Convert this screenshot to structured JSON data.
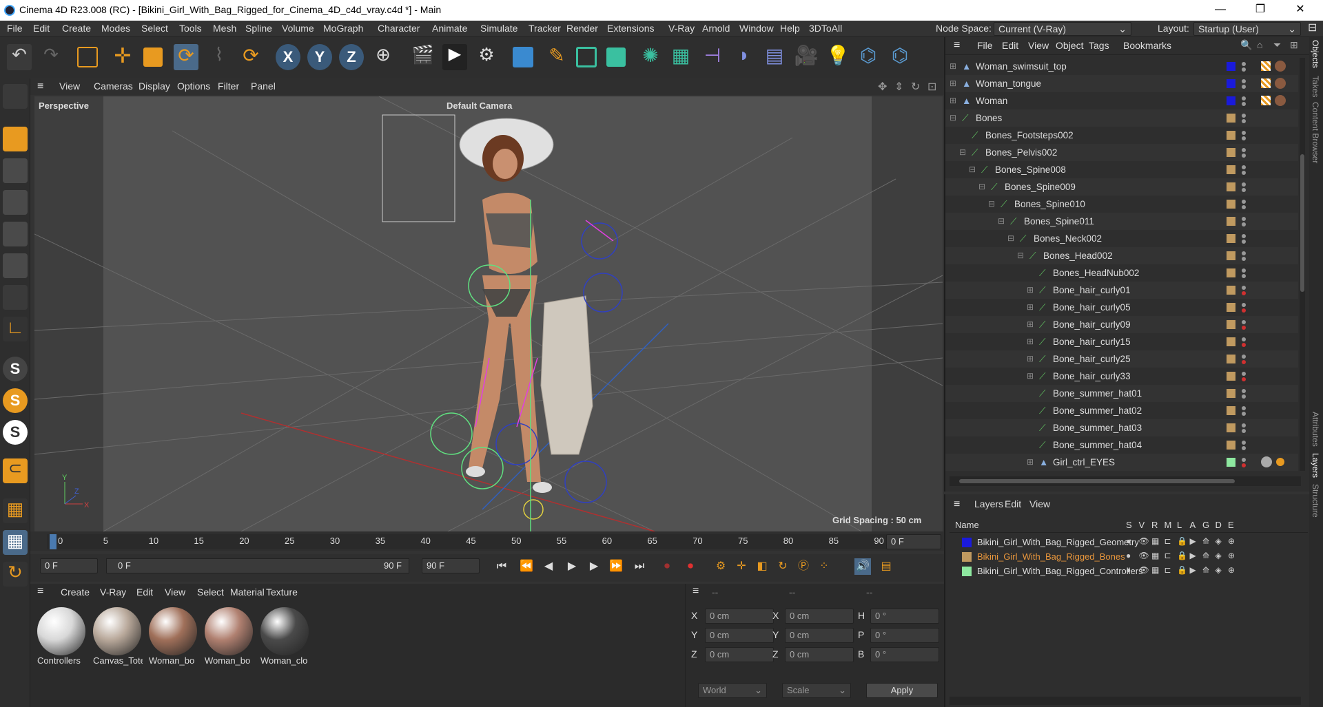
{
  "window": {
    "title": "Cinema 4D R23.008 (RC) - [Bikini_Girl_With_Bag_Rigged_for_Cinema_4D_c4d_vray.c4d *] - Main",
    "min": "—",
    "max": "❐",
    "close": "✕"
  },
  "menubar": {
    "items": [
      "File",
      "Edit",
      "Create",
      "Modes",
      "Select",
      "Tools",
      "Mesh",
      "Spline",
      "Volume",
      "MoGraph",
      "Character",
      "Animate",
      "Simulate",
      "Tracker",
      "Render",
      "Extensions",
      "V-Ray",
      "Arnold",
      "Window",
      "Help",
      "3DToAll"
    ],
    "node_space_label": "Node Space:",
    "node_space_value": "Current (V-Ray)",
    "layout_label": "Layout:",
    "layout_value": "Startup (User)"
  },
  "viewport": {
    "menu": [
      "View",
      "Cameras",
      "Display",
      "Options",
      "Filter",
      "Panel"
    ],
    "name": "Perspective",
    "camera": "Default Camera",
    "grid_spacing": "Grid Spacing : 50 cm"
  },
  "timeline": {
    "ticks": [
      "0",
      "5",
      "10",
      "15",
      "20",
      "25",
      "30",
      "35",
      "40",
      "45",
      "50",
      "55",
      "60",
      "65",
      "70",
      "75",
      "80",
      "85",
      "90"
    ],
    "current_frame": "0 F"
  },
  "transport": {
    "start": "0 F",
    "range_start": "0 F",
    "range_end": "90 F",
    "end": "90 F"
  },
  "materials": {
    "menu": [
      "Create",
      "V-Ray",
      "Edit",
      "View",
      "Select",
      "Material",
      "Texture"
    ],
    "items": [
      {
        "name": "Controllers",
        "color": "#d8d8d8"
      },
      {
        "name": "Canvas_Tote",
        "color": "#b8a89a"
      },
      {
        "name": "Woman_bo",
        "color": "#a0705a"
      },
      {
        "name": "Woman_bo",
        "color": "#b08070"
      },
      {
        "name": "Woman_clo",
        "color": "#4a4a4a"
      }
    ]
  },
  "coords": {
    "headers": [
      "--",
      "--",
      "--"
    ],
    "rows": [
      {
        "a": "X",
        "av": "0 cm",
        "b": "X",
        "bv": "0 cm",
        "c": "H",
        "cv": "0 °"
      },
      {
        "a": "Y",
        "av": "0 cm",
        "b": "Y",
        "bv": "0 cm",
        "c": "P",
        "cv": "0 °"
      },
      {
        "a": "Z",
        "av": "0 cm",
        "b": "Z",
        "bv": "0 cm",
        "c": "B",
        "cv": "0 °"
      }
    ],
    "mode": "World",
    "scale": "Scale",
    "apply": "Apply"
  },
  "objects": {
    "menu": [
      "File",
      "Edit",
      "View",
      "Object",
      "Tags",
      "Bookmarks"
    ],
    "rows": [
      {
        "name": "Woman_swimsuit_top",
        "indent": 0,
        "type": "mesh",
        "color": "#1a1adb",
        "expand": "+"
      },
      {
        "name": "Woman_tongue",
        "indent": 0,
        "type": "mesh",
        "color": "#1a1adb",
        "expand": "+"
      },
      {
        "name": "Woman",
        "indent": 0,
        "type": "mesh",
        "color": "#1a1adb",
        "expand": "+"
      },
      {
        "name": "Bones",
        "indent": 0,
        "type": "bone",
        "color": "#c09a60",
        "expand": "−"
      },
      {
        "name": "Bones_Footsteps002",
        "indent": 1,
        "type": "bone",
        "color": "#c09a60",
        "expand": ""
      },
      {
        "name": "Bones_Pelvis002",
        "indent": 1,
        "type": "bone",
        "color": "#c09a60",
        "expand": "−"
      },
      {
        "name": "Bones_Spine008",
        "indent": 2,
        "type": "bone",
        "color": "#c09a60",
        "expand": "−"
      },
      {
        "name": "Bones_Spine009",
        "indent": 3,
        "type": "bone",
        "color": "#c09a60",
        "expand": "−"
      },
      {
        "name": "Bones_Spine010",
        "indent": 4,
        "type": "bone",
        "color": "#c09a60",
        "expand": "−"
      },
      {
        "name": "Bones_Spine011",
        "indent": 5,
        "type": "bone",
        "color": "#c09a60",
        "expand": "−"
      },
      {
        "name": "Bones_Neck002",
        "indent": 6,
        "type": "bone",
        "color": "#c09a60",
        "expand": "−"
      },
      {
        "name": "Bones_Head002",
        "indent": 7,
        "type": "bone",
        "color": "#c09a60",
        "expand": "−"
      },
      {
        "name": "Bones_HeadNub002",
        "indent": 8,
        "type": "bone",
        "color": "#c09a60",
        "expand": ""
      },
      {
        "name": "Bone_hair_curly01",
        "indent": 8,
        "type": "bone",
        "color": "#c09a60",
        "expand": "+"
      },
      {
        "name": "Bone_hair_curly05",
        "indent": 8,
        "type": "bone",
        "color": "#c09a60",
        "expand": "+"
      },
      {
        "name": "Bone_hair_curly09",
        "indent": 8,
        "type": "bone",
        "color": "#c09a60",
        "expand": "+"
      },
      {
        "name": "Bone_hair_curly15",
        "indent": 8,
        "type": "bone",
        "color": "#c09a60",
        "expand": "+"
      },
      {
        "name": "Bone_hair_curly25",
        "indent": 8,
        "type": "bone",
        "color": "#c09a60",
        "expand": "+"
      },
      {
        "name": "Bone_hair_curly33",
        "indent": 8,
        "type": "bone",
        "color": "#c09a60",
        "expand": "+"
      },
      {
        "name": "Bone_summer_hat01",
        "indent": 8,
        "type": "bone",
        "color": "#c09a60",
        "expand": ""
      },
      {
        "name": "Bone_summer_hat02",
        "indent": 8,
        "type": "bone",
        "color": "#c09a60",
        "expand": ""
      },
      {
        "name": "Bone_summer_hat03",
        "indent": 8,
        "type": "bone",
        "color": "#c09a60",
        "expand": ""
      },
      {
        "name": "Bone_summer_hat04",
        "indent": 8,
        "type": "bone",
        "color": "#c09a60",
        "expand": ""
      },
      {
        "name": "Girl_ctrl_EYES",
        "indent": 8,
        "type": "null",
        "color": "#8ee8a0",
        "expand": "+"
      }
    ]
  },
  "layers": {
    "menu": [
      "Layers",
      "Edit",
      "View"
    ],
    "col_name": "Name",
    "cols": [
      "S",
      "V",
      "R",
      "M",
      "L",
      "A",
      "G",
      "D",
      "E"
    ],
    "rows": [
      {
        "name": "Bikini_Girl_With_Bag_Rigged_Geometry",
        "color": "#1a1adb",
        "text_color": "#dddddd"
      },
      {
        "name": "Bikini_Girl_With_Bag_Rigged_Bones",
        "color": "#c09a60",
        "text_color": "#e8963c"
      },
      {
        "name": "Bikini_Girl_With_Bag_Rigged_Controllers",
        "color": "#8ee8a0",
        "text_color": "#dddddd"
      }
    ]
  },
  "sidetabs": [
    "Objects",
    "Takes",
    "Content Browser",
    "Attributes",
    "Layers",
    "Structure"
  ]
}
